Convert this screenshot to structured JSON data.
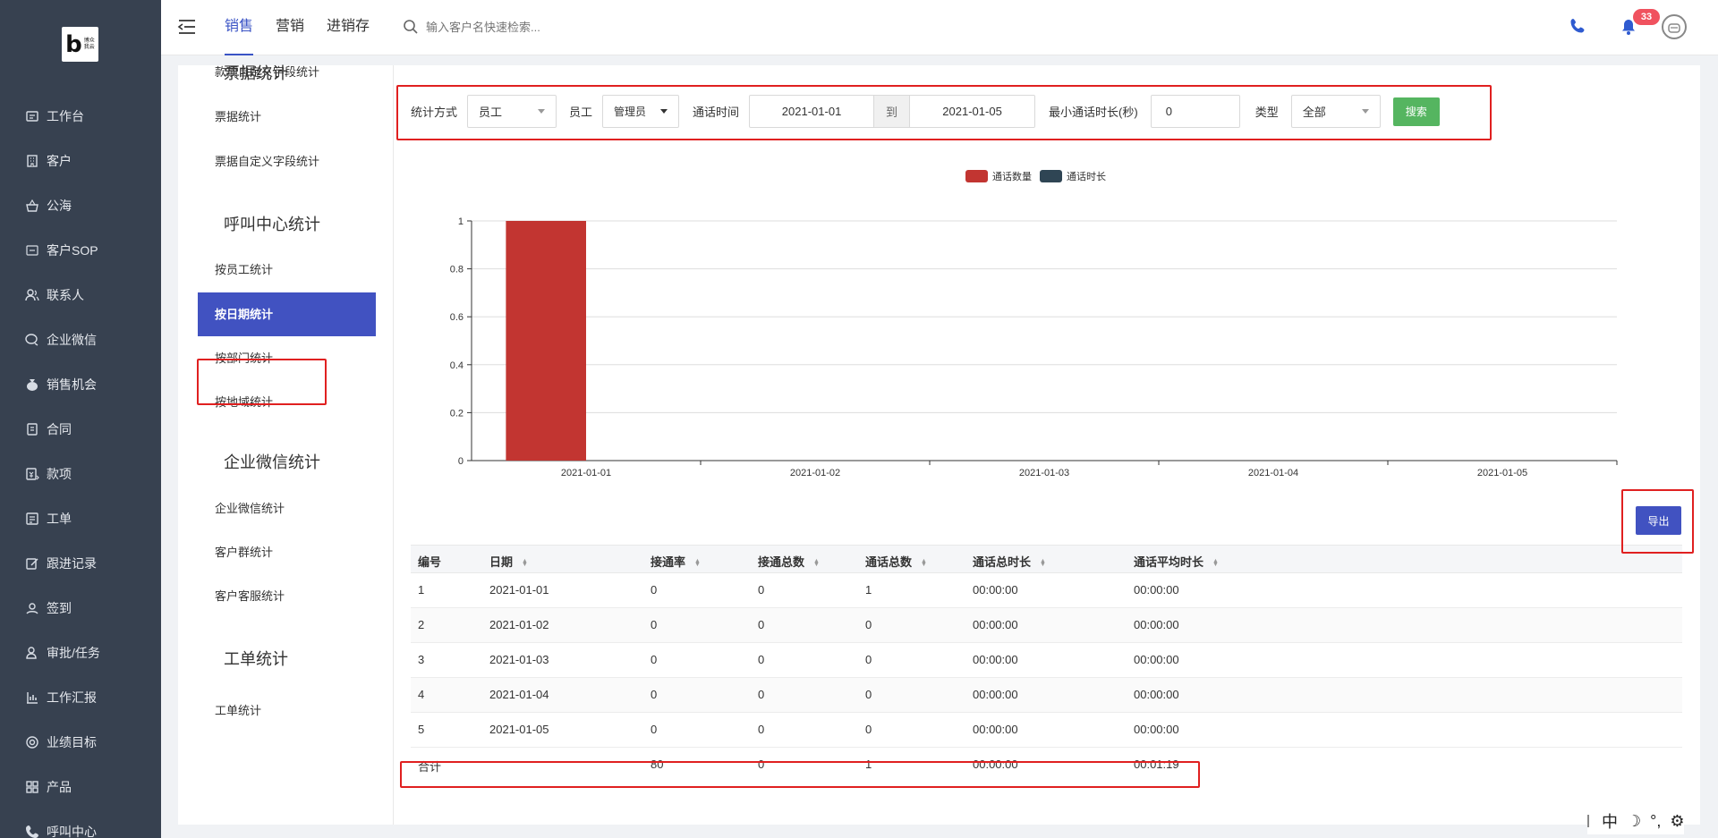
{
  "logo": {
    "letter": "b",
    "text": "博众\n我云"
  },
  "sidebar": {
    "items": [
      {
        "label": "工作台",
        "icon": "dashboard-icon"
      },
      {
        "label": "客户",
        "icon": "building-icon"
      },
      {
        "label": "公海",
        "icon": "basket-icon"
      },
      {
        "label": "客户SOP",
        "icon": "sop-icon"
      },
      {
        "label": "联系人",
        "icon": "contacts-icon"
      },
      {
        "label": "企业微信",
        "icon": "wechat-work-icon"
      },
      {
        "label": "销售机会",
        "icon": "money-bag-icon"
      },
      {
        "label": "合同",
        "icon": "contract-icon"
      },
      {
        "label": "款项",
        "icon": "payment-icon"
      },
      {
        "label": "工单",
        "icon": "ticket-icon"
      },
      {
        "label": "跟进记录",
        "icon": "edit-record-icon"
      },
      {
        "label": "签到",
        "icon": "location-pin-icon"
      },
      {
        "label": "审批/任务",
        "icon": "approval-icon"
      },
      {
        "label": "工作汇报",
        "icon": "report-icon"
      },
      {
        "label": "业绩目标",
        "icon": "target-icon"
      },
      {
        "label": "产品",
        "icon": "product-grid-icon"
      },
      {
        "label": "呼叫中心",
        "icon": "phone-icon"
      }
    ]
  },
  "topbar": {
    "tabs": [
      {
        "label": "销售",
        "active": true
      },
      {
        "label": "营销",
        "active": false
      },
      {
        "label": "进销存",
        "active": false
      }
    ],
    "search_placeholder": "输入客户名快速检索...",
    "notification_count": "33"
  },
  "subnav": {
    "items": [
      {
        "type": "item",
        "label": "款项自定义字段统计",
        "top": -1
      },
      {
        "type": "group",
        "label": "票据统计"
      },
      {
        "type": "item",
        "label": "票据统计"
      },
      {
        "type": "item",
        "label": "票据自定义字段统计"
      },
      {
        "type": "group",
        "label": "呼叫中心统计"
      },
      {
        "type": "item",
        "label": "按员工统计"
      },
      {
        "type": "item",
        "label": "按日期统计",
        "active": true
      },
      {
        "type": "item",
        "label": "按部门统计"
      },
      {
        "type": "item",
        "label": "按地域统计"
      },
      {
        "type": "group",
        "label": "企业微信统计"
      },
      {
        "type": "item",
        "label": "企业微信统计"
      },
      {
        "type": "item",
        "label": "客户群统计"
      },
      {
        "type": "item",
        "label": "客户客服统计"
      },
      {
        "type": "group",
        "label": "工单统计"
      },
      {
        "type": "item",
        "label": "工单统计"
      }
    ]
  },
  "filters": {
    "stat_mode_label": "统计方式",
    "stat_mode_value": "员工",
    "employee_label": "员工",
    "employee_value": "管理员",
    "call_time_label": "通话时间",
    "date_from": "2021-01-01",
    "date_to_sep": "到",
    "date_to": "2021-01-05",
    "min_duration_label": "最小通话时长(秒)",
    "min_duration_value": "0",
    "type_label": "类型",
    "type_value": "全部",
    "search_button": "搜索"
  },
  "chart_data": {
    "type": "bar",
    "categories": [
      "2021-01-01",
      "2021-01-02",
      "2021-01-03",
      "2021-01-04",
      "2021-01-05"
    ],
    "series": [
      {
        "name": "通话数量",
        "values": [
          1,
          0,
          0,
          0,
          0
        ],
        "color": "#c23531"
      },
      {
        "name": "通话时长",
        "values": [
          0,
          0,
          0,
          0,
          0
        ],
        "color": "#2f4554"
      }
    ],
    "ylim": [
      0,
      1
    ],
    "yticks": [
      0,
      0.2,
      0.4,
      0.6,
      0.8,
      1
    ],
    "ytick_labels": [
      "0",
      "0.2",
      "0.4",
      "0.6",
      "0.8",
      "1"
    ],
    "grid": true,
    "legend_position": "top-center"
  },
  "export_button": "导出",
  "table": {
    "headers": [
      {
        "label": "编号",
        "sortable": false
      },
      {
        "label": "日期",
        "sortable": true
      },
      {
        "label": "接通率",
        "sortable": true
      },
      {
        "label": "接通总数",
        "sortable": true
      },
      {
        "label": "通话总数",
        "sortable": true
      },
      {
        "label": "通话总时长",
        "sortable": true
      },
      {
        "label": "通话平均时长",
        "sortable": true
      }
    ],
    "rows": [
      [
        "1",
        "2021-01-01",
        "0",
        "0",
        "1",
        "00:00:00",
        "00:00:00"
      ],
      [
        "2",
        "2021-01-02",
        "0",
        "0",
        "0",
        "00:00:00",
        "00:00:00"
      ],
      [
        "3",
        "2021-01-03",
        "0",
        "0",
        "0",
        "00:00:00",
        "00:00:00"
      ],
      [
        "4",
        "2021-01-04",
        "0",
        "0",
        "0",
        "00:00:00",
        "00:00:00"
      ],
      [
        "5",
        "2021-01-05",
        "0",
        "0",
        "0",
        "00:00:00",
        "00:00:00"
      ]
    ],
    "total": [
      "合计",
      "",
      "80",
      "0",
      "1",
      "00:00:00",
      "00:01:19"
    ]
  },
  "ime": {
    "mode": "中",
    "moon": "☽",
    "punct": "°,",
    "settings": "⚙"
  }
}
